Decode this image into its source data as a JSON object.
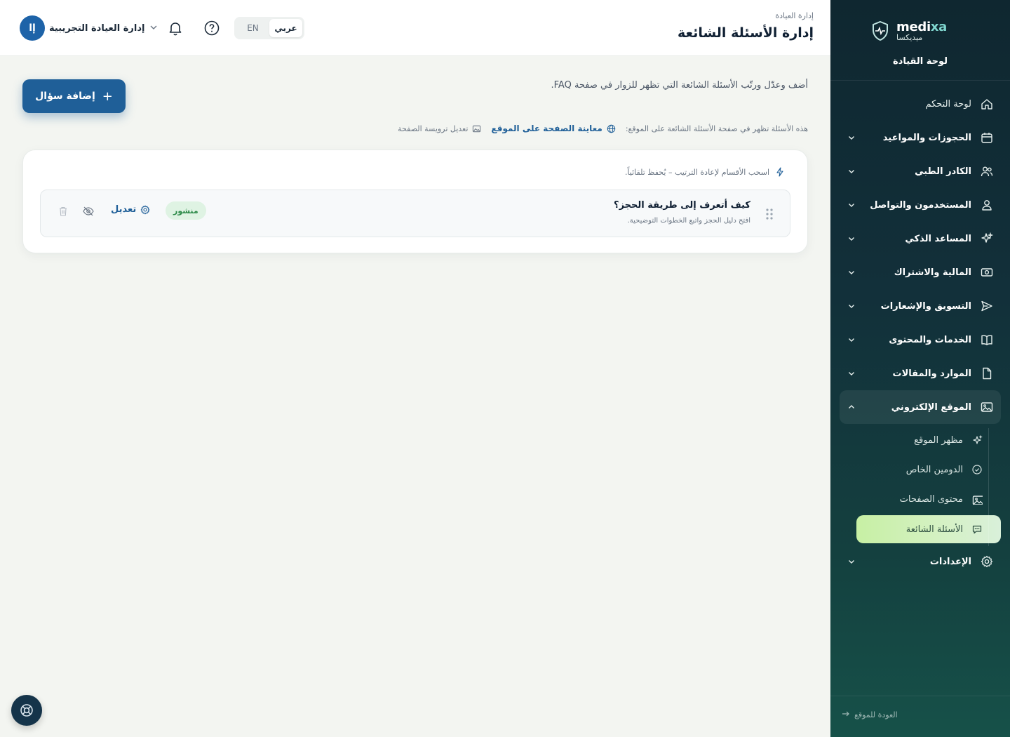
{
  "brand": {
    "name_en_main": "medi",
    "name_en_accent": "xa",
    "name_ar": "ميديكسا",
    "subtitle": "لوحة القيادة"
  },
  "nav": [
    {
      "label": "لوحة التحكم",
      "icon": "home-icon",
      "expandable": false
    },
    {
      "label": "الحجوزات والمواعيد",
      "icon": "calendar-icon",
      "expandable": true
    },
    {
      "label": "الكادر الطبي",
      "icon": "users-icon",
      "expandable": true
    },
    {
      "label": "المستخدمون والتواصل",
      "icon": "user-icon",
      "expandable": true
    },
    {
      "label": "المساعد الذكي",
      "icon": "sparkles-icon",
      "expandable": true
    },
    {
      "label": "المالية والاشتراك",
      "icon": "money-icon",
      "expandable": true
    },
    {
      "label": "التسويق والإشعارات",
      "icon": "send-icon",
      "expandable": true
    },
    {
      "label": "الخدمات والمحتوى",
      "icon": "book-icon",
      "expandable": true
    },
    {
      "label": "الموارد والمقالات",
      "icon": "file-icon",
      "expandable": true
    },
    {
      "label": "الموقع الإلكتروني",
      "icon": "image-icon",
      "expandable": true,
      "open": true
    },
    {
      "label": "الإعدادات",
      "icon": "gear-icon",
      "expandable": true
    }
  ],
  "website_sub": [
    {
      "label": "مظهر الموقع",
      "icon": "sparkle-icon"
    },
    {
      "label": "الدومين الخاص",
      "icon": "check-circle-icon"
    },
    {
      "label": "محتوى الصفحات",
      "icon": "image-icon"
    },
    {
      "label": "الأسئلة الشائعة",
      "icon": "chat-icon",
      "active": true
    }
  ],
  "back_link": "العودة للموقع",
  "header": {
    "breadcrumb": "إدارة العيادة",
    "title": "إدارة الأسئلة الشائعة",
    "lang_ar": "عربي",
    "lang_en": "EN",
    "active_lang": "ar",
    "avatar_initials": "إا",
    "user_name": "إدارة العيادة التجريبية"
  },
  "main": {
    "intro": "أضف وعدّل ورتّب الأسئلة الشائعة التي تظهر للزوار في صفحة FAQ.",
    "add_button": "إضافة سؤال",
    "info_text": "هذه الأسئلة تظهر في صفحة الأسئلة الشائعة على الموقع:",
    "preview_link": "معاينة الصفحة على الموقع",
    "edit_header_link": "تعديل ترويسة الصفحة",
    "drag_hint": "اسحب الأقسام لإعادة الترتيب – يُحفظ تلقائياً.",
    "faqs": [
      {
        "question": "كيف أتعرف إلى طريقة الحجز؟",
        "answer": "افتح دليل الحجز واتبع الخطوات التوضيحية.",
        "status": "منشور",
        "edit_label": "تعديل"
      }
    ]
  },
  "colors": {
    "primary": "#1f5f98",
    "sidebar_top": "#0f2730",
    "sidebar_bottom": "#165149",
    "active_sub": "#c7f0a4",
    "status_bg": "#dff3e3",
    "status_text": "#2d8a49"
  }
}
